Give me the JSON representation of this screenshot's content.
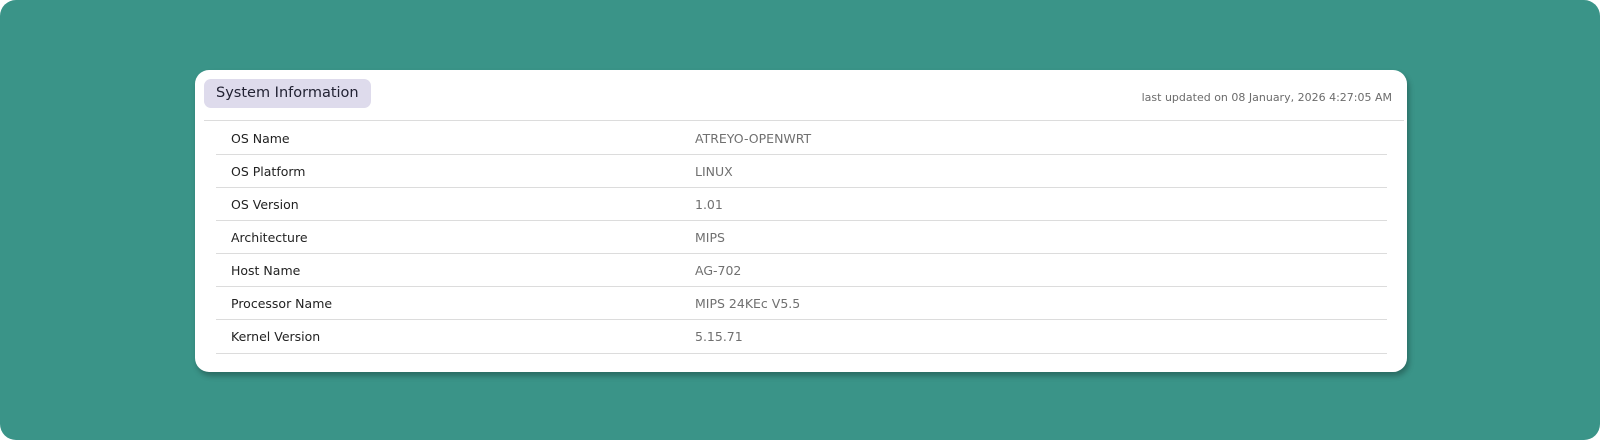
{
  "panel": {
    "title": "System Information",
    "last_updated": "last updated on 08 January, 2026 4:27:05 AM"
  },
  "rows": [
    {
      "label": "OS Name",
      "value": "ATREYO-OPENWRT"
    },
    {
      "label": "OS Platform",
      "value": "LINUX"
    },
    {
      "label": "OS Version",
      "value": "1.01"
    },
    {
      "label": "Architecture",
      "value": "MIPS"
    },
    {
      "label": "Host Name",
      "value": "AG-702"
    },
    {
      "label": "Processor Name",
      "value": "MIPS 24KEc V5.5"
    },
    {
      "label": "Kernel Version",
      "value": "5.15.71"
    }
  ],
  "colors": {
    "background": "#3a9488",
    "card": "#ffffff",
    "title_chip": "#dedbec",
    "divider": "#dcdcdc"
  }
}
